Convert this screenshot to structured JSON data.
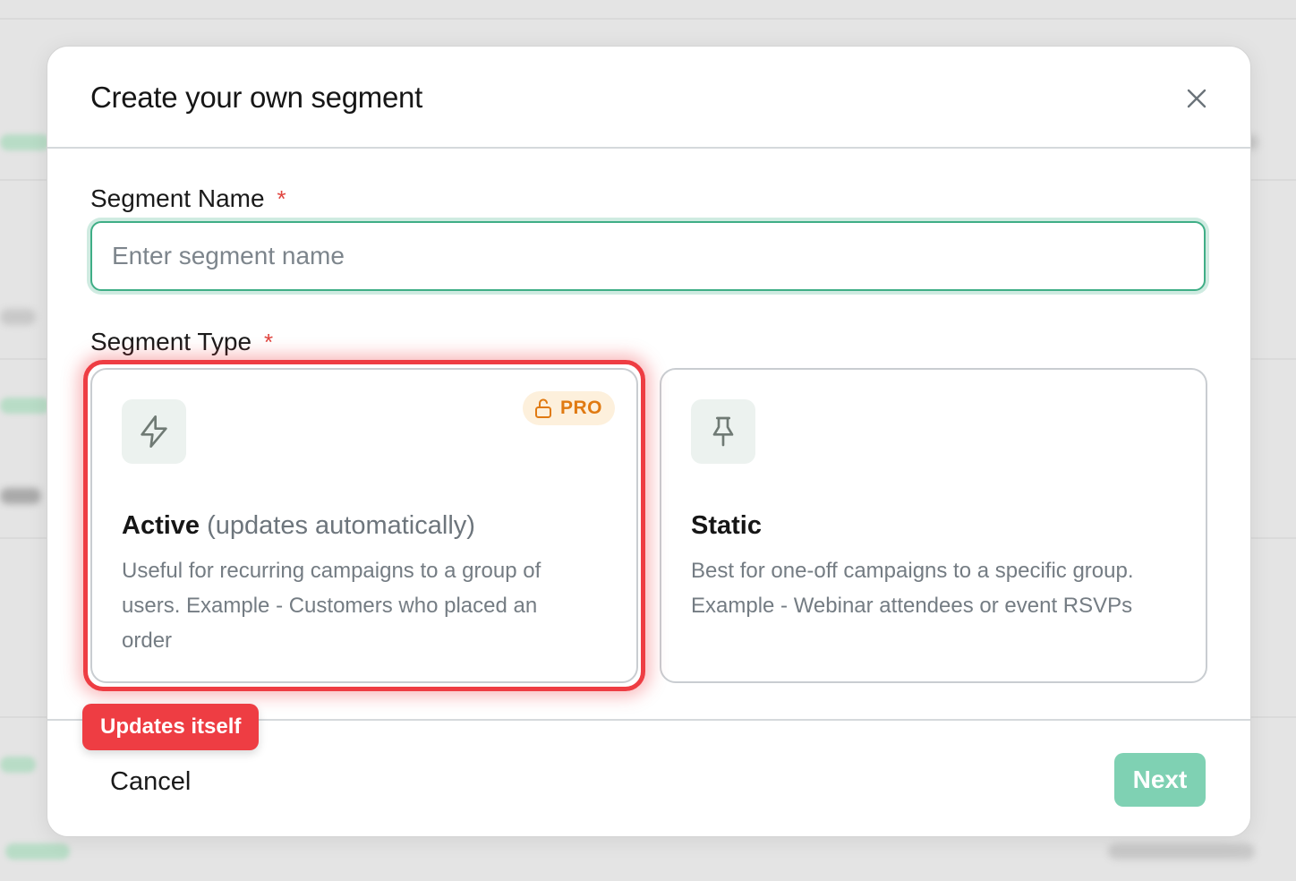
{
  "modal": {
    "title": "Create your own segment"
  },
  "segment_name": {
    "label": "Segment Name",
    "required_mark": "*",
    "placeholder": "Enter segment name",
    "value": ""
  },
  "segment_type": {
    "label": "Segment Type",
    "required_mark": "*",
    "options": [
      {
        "title": "Active",
        "subtitle": "(updates automatically)",
        "description": "Useful for recurring campaigns to a group of users. Example - Customers who placed an order",
        "icon": "lightning-icon",
        "badge": "PRO",
        "badge_icon": "unlock-icon",
        "highlighted": true
      },
      {
        "title": "Static",
        "subtitle": "",
        "description": "Best for one-off campaigns to a specific group. Example - Webinar attendees or event RSVPs",
        "icon": "pin-icon",
        "highlighted": false
      }
    ]
  },
  "annotation": {
    "label": "Updates itself",
    "color": "#ee3d43"
  },
  "footer": {
    "cancel_label": "Cancel",
    "next_label": "Next"
  },
  "colors": {
    "accent": "#3fae86",
    "next_disabled": "#7fd1b3",
    "pro_badge_text": "#e07a12",
    "required": "#e0453f"
  }
}
